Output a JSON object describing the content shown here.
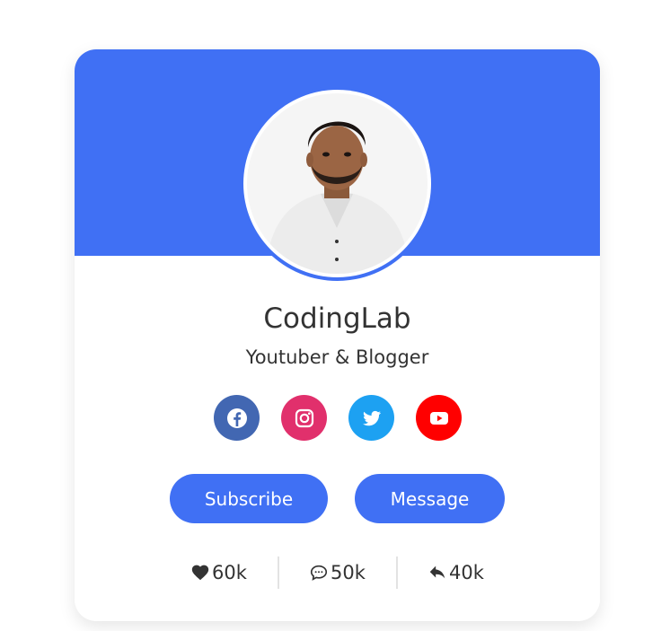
{
  "profile": {
    "name": "CodingLab",
    "role": "Youtuber & Blogger"
  },
  "socials": [
    {
      "icon": "facebook-icon",
      "color": "#4267b2"
    },
    {
      "icon": "instagram-icon",
      "color": "#e1306c"
    },
    {
      "icon": "twitter-icon",
      "color": "#1da1f2"
    },
    {
      "icon": "youtube-icon",
      "color": "#ff0000"
    }
  ],
  "buttons": {
    "subscribe_label": "Subscribe",
    "message_label": "Message"
  },
  "stats": {
    "likes": "60k",
    "comments": "50k",
    "shares": "40k"
  },
  "colors": {
    "accent": "#4070f4"
  }
}
